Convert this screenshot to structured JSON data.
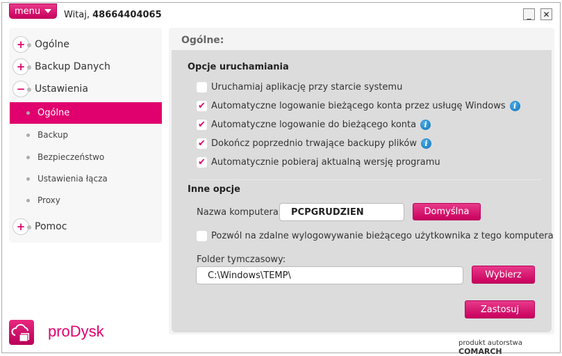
{
  "header": {
    "menu_label": "menu",
    "welcome_prefix": "Witaj,",
    "user_number": "48664404065",
    "minimize": "_",
    "close": "✕"
  },
  "sidebar": {
    "top_items": [
      {
        "label": "Ogólne",
        "sign": "+"
      },
      {
        "label": "Backup Danych",
        "sign": "+"
      },
      {
        "label": "Ustawienia",
        "sign": "−"
      }
    ],
    "sub_items": [
      {
        "label": "Ogólne",
        "active": true
      },
      {
        "label": "Backup"
      },
      {
        "label": "Bezpieczeństwo"
      },
      {
        "label": "Ustawienia łącza"
      },
      {
        "label": "Proxy"
      }
    ],
    "bottom_item": {
      "label": "Pomoc",
      "sign": "+"
    }
  },
  "main": {
    "title": "Ogólne:",
    "startup": {
      "heading": "Opcje uruchamiania",
      "options": [
        {
          "label": "Uruchamiaj aplikację przy starcie systemu",
          "checked": false,
          "info": false
        },
        {
          "label": "Automatyczne logowanie bieżącego konta przez usługę Windows",
          "checked": true,
          "info": true
        },
        {
          "label": "Automatyczne logowanie do bieżącego konta",
          "checked": true,
          "info": true
        },
        {
          "label": "Dokończ poprzednio trwające backupy plików",
          "checked": true,
          "info": true
        },
        {
          "label": "Automatycznie pobieraj aktualną wersję programu",
          "checked": true,
          "info": false
        }
      ]
    },
    "other": {
      "heading": "Inne opcje",
      "computer_name_label": "Nazwa komputera:",
      "computer_name_value": "PCPGRUDZIEN",
      "default_button": "Domyślna",
      "remote_logout_label": "Pozwól na zdalne wylogowywanie bieżącego użytkownika z tego komputera",
      "remote_logout_checked": false,
      "temp_folder_label": "Folder tymczasowy:",
      "temp_folder_value": "C:\\Windows\\TEMP\\",
      "choose_button": "Wybierz"
    },
    "apply_button": "Zastosuj"
  },
  "footer": {
    "brand": "proDysk",
    "credit_prefix": "produkt autorstwa",
    "credit_company": "COMARCH"
  },
  "colors": {
    "accent": "#e0006e",
    "panel": "#dcdcdc",
    "info": "#0b6fb8"
  }
}
